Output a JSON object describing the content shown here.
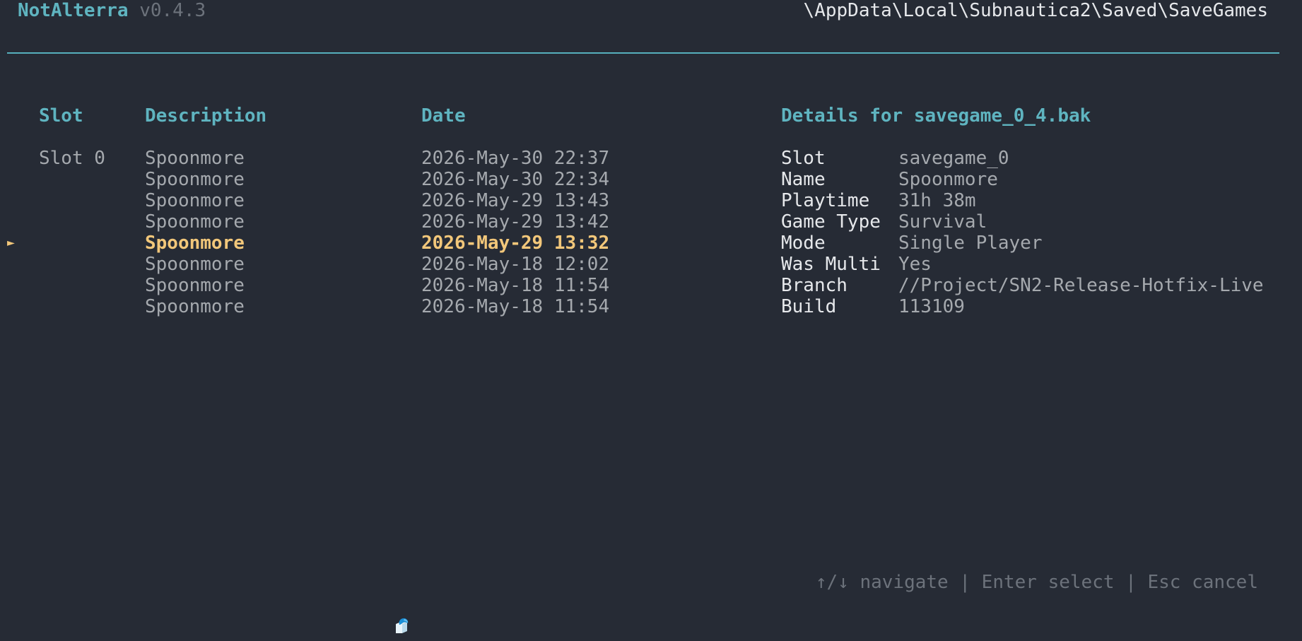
{
  "app": {
    "name": "NotAlterra",
    "version": "v0.4.3",
    "path": "\\AppData\\Local\\Subnautica2\\Saved\\SaveGames"
  },
  "table": {
    "headers": {
      "slot": "Slot",
      "description": "Description",
      "date": "Date"
    },
    "rows": [
      {
        "slot": "Slot 0",
        "description": "Spoonmore",
        "date": "2026-May-30 22:37"
      },
      {
        "slot": "",
        "description": "Spoonmore",
        "date": "2026-May-30 22:34"
      },
      {
        "slot": "",
        "description": "Spoonmore",
        "date": "2026-May-29 13:43"
      },
      {
        "slot": "",
        "description": "Spoonmore",
        "date": "2026-May-29 13:42"
      },
      {
        "slot": "",
        "description": "Spoonmore",
        "date": "2026-May-29 13:32",
        "selected": true
      },
      {
        "slot": "",
        "description": "Spoonmore",
        "date": "2026-May-18 12:02"
      },
      {
        "slot": "",
        "description": "Spoonmore",
        "date": "2026-May-18 11:54"
      },
      {
        "slot": "",
        "description": "Spoonmore",
        "date": "2026-May-18 11:54"
      }
    ],
    "pointer_glyph": "►"
  },
  "details": {
    "title": "Details for savegame_0_4.bak",
    "fields": [
      {
        "label": "Slot",
        "value": "savegame_0"
      },
      {
        "label": "Name",
        "value": "Spoonmore"
      },
      {
        "label": "Playtime",
        "value": "31h 38m"
      },
      {
        "label": "Game Type",
        "value": "Survival"
      },
      {
        "label": "Mode",
        "value": "Single Player"
      },
      {
        "label": "Was Multi",
        "value": "Yes"
      },
      {
        "label": "Branch",
        "value": "//Project/SN2-Release-Hotfix-Live"
      },
      {
        "label": "Build",
        "value": "113109"
      }
    ]
  },
  "footer": {
    "hint": "↑/↓ navigate | Enter select | Esc cancel"
  },
  "colors": {
    "background": "#262b35",
    "accent": "#5fb4c0",
    "selected": "#f2c77a",
    "muted": "#6c727b",
    "text": "#a5a9ae",
    "bright": "#e6e8eb"
  },
  "icons": {
    "cursor": "mouse-cursor-icon"
  }
}
